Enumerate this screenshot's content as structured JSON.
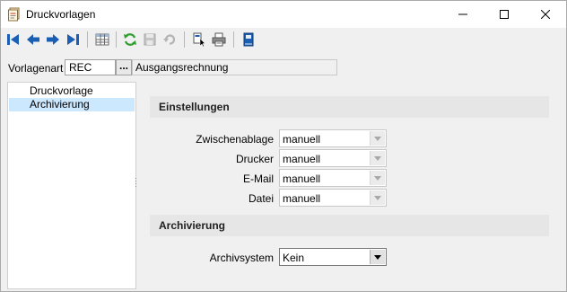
{
  "window": {
    "title": "Druckvorlagen",
    "minimize": "minimize",
    "maximize": "maximize",
    "close": "close"
  },
  "toolbar": {
    "buttons": [
      "first-record",
      "previous-record",
      "next-record",
      "last-record",
      "table-view",
      "refresh",
      "save",
      "undo",
      "document-select",
      "print",
      "book"
    ]
  },
  "vorlage": {
    "label": "Vorlagenart",
    "code": "REC",
    "dots": "...",
    "description": "Ausgangsrechnung"
  },
  "tree": {
    "items": [
      {
        "label": "Druckvorlage",
        "selected": false
      },
      {
        "label": "Archivierung",
        "selected": true
      }
    ]
  },
  "settings": {
    "heading": "Einstellungen",
    "fields": [
      {
        "label": "Zwischenablage",
        "value": "manuell"
      },
      {
        "label": "Drucker",
        "value": "manuell"
      },
      {
        "label": "E-Mail",
        "value": "manuell"
      },
      {
        "label": "Datei",
        "value": "manuell"
      }
    ]
  },
  "archive": {
    "heading": "Archivierung",
    "label": "Archivsystem",
    "value": "Kein"
  },
  "colors": {
    "selection": "#cce8ff",
    "nav_blue": "#1a5fb4",
    "refresh_green": "#2e9d2e"
  }
}
